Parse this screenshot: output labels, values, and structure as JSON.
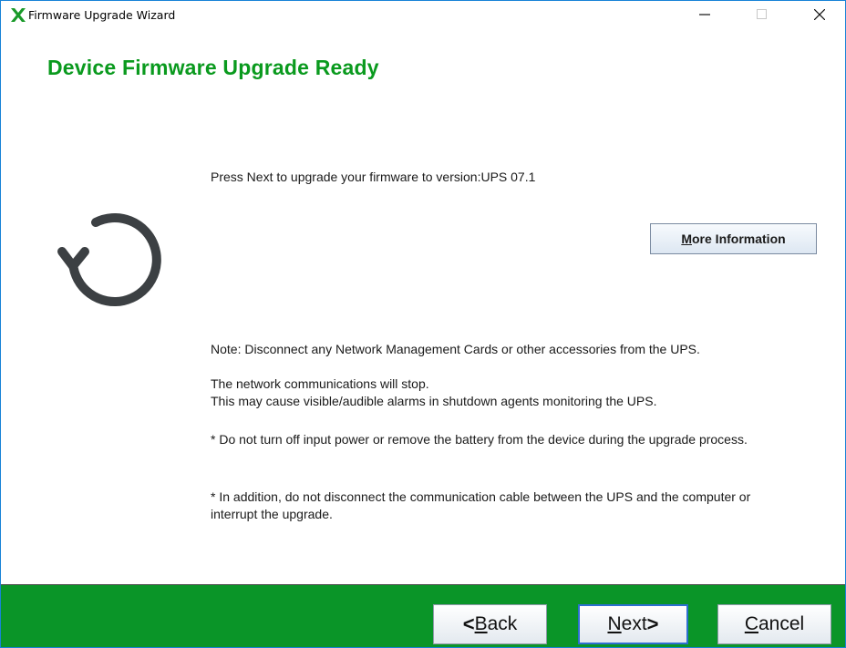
{
  "window": {
    "title": "Firmware Upgrade Wizard",
    "icon": "x-icon",
    "controls": [
      "minimize-icon",
      "maximize-icon",
      "close-icon"
    ]
  },
  "heading": "Device Firmware Upgrade Ready",
  "icon": "refresh-icon",
  "intro": "Press Next to upgrade your firmware to version:UPS 07.1",
  "more_info_label": "More Information",
  "note": "Note: Disconnect any Network Management Cards or other accessories from the UPS.",
  "network_line1": "The network communications will stop.",
  "network_line2": "This may cause visible/audible alarms in shutdown agents monitoring the UPS.",
  "warning_power": "* Do not turn off input power or remove the battery from the device during the upgrade process.",
  "warning_cable": "* In addition, do not disconnect the communication cable between the UPS and the computer or interrupt the upgrade.",
  "buttons": {
    "back": "Back",
    "next": "Next",
    "cancel": "Cancel"
  },
  "colors": {
    "accent": "#0a9a1e",
    "footer": "#0a9528",
    "icon": "#3c4043"
  }
}
